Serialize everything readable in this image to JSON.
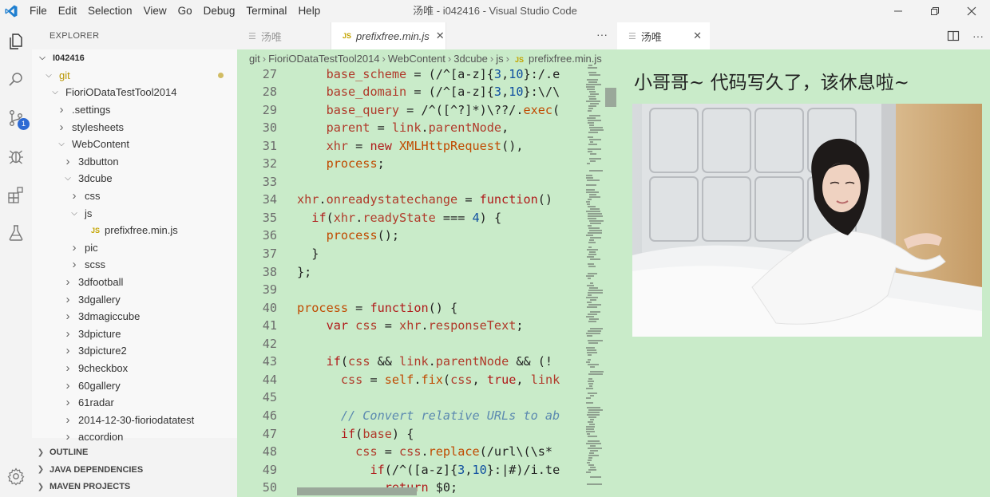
{
  "titlebar": {
    "menu": [
      "File",
      "Edit",
      "Selection",
      "View",
      "Go",
      "Debug",
      "Terminal",
      "Help"
    ],
    "title": "汤唯 - i042416 - Visual Studio Code"
  },
  "activity_bar": {
    "icons": [
      "files-icon",
      "search-icon",
      "source-control-icon",
      "debug-icon",
      "extensions-icon",
      "test-flask-icon"
    ],
    "scm_badge": "1",
    "bottom_icon": "gear-icon"
  },
  "sidebar": {
    "header": "EXPLORER",
    "tree": [
      {
        "label": "I042416",
        "depth": 0,
        "chev": "down",
        "bold": true
      },
      {
        "label": "git",
        "depth": 1,
        "chev": "down",
        "git": true,
        "modified": true
      },
      {
        "label": "FioriODataTestTool2014",
        "depth": 2,
        "chev": "down"
      },
      {
        "label": ".settings",
        "depth": 3,
        "chev": "right"
      },
      {
        "label": "stylesheets",
        "depth": 3,
        "chev": "right"
      },
      {
        "label": "WebContent",
        "depth": 3,
        "chev": "down"
      },
      {
        "label": "3dbutton",
        "depth": 4,
        "chev": "right"
      },
      {
        "label": "3dcube",
        "depth": 4,
        "chev": "down"
      },
      {
        "label": "css",
        "depth": 5,
        "chev": "right"
      },
      {
        "label": "js",
        "depth": 5,
        "chev": "down"
      },
      {
        "label": "prefixfree.min.js",
        "depth": 6,
        "chev": "",
        "js": true
      },
      {
        "label": "pic",
        "depth": 5,
        "chev": "right"
      },
      {
        "label": "scss",
        "depth": 5,
        "chev": "right"
      },
      {
        "label": "3dfootball",
        "depth": 4,
        "chev": "right"
      },
      {
        "label": "3dgallery",
        "depth": 4,
        "chev": "right"
      },
      {
        "label": "3dmagiccube",
        "depth": 4,
        "chev": "right"
      },
      {
        "label": "3dpicture",
        "depth": 4,
        "chev": "right"
      },
      {
        "label": "3dpicture2",
        "depth": 4,
        "chev": "right"
      },
      {
        "label": "9checkbox",
        "depth": 4,
        "chev": "right"
      },
      {
        "label": "60gallery",
        "depth": 4,
        "chev": "right"
      },
      {
        "label": "61radar",
        "depth": 4,
        "chev": "right"
      },
      {
        "label": "2014-12-30-fioriodatatest",
        "depth": 4,
        "chev": "right"
      },
      {
        "label": "accordion",
        "depth": 4,
        "chev": "right"
      }
    ],
    "sections": [
      "OUTLINE",
      "JAVA DEPENDENCIES",
      "MAVEN PROJECTS"
    ]
  },
  "tabs": {
    "inactive_label": "汤唯",
    "active_label": "prefixfree.min.js",
    "js_badge": "JS",
    "more": "···"
  },
  "breadcrumb": [
    "git",
    "FioriODataTestTool2014",
    "WebContent",
    "3dcube",
    "js",
    "prefixfree.min.js"
  ],
  "code": [
    {
      "n": "27",
      "html": "    base_scheme = (/^[a-z]{3,10}:/.e"
    },
    {
      "n": "28",
      "html": "    base_domain = (/^[a-z]{3,10}:\\/\\"
    },
    {
      "n": "29",
      "html": "    base_query = /^([^?]*)\\??/.exec("
    },
    {
      "n": "30",
      "html": "    parent = link.parentNode,"
    },
    {
      "n": "31",
      "html": "    xhr = new XMLHttpRequest(),"
    },
    {
      "n": "32",
      "html": "    process;"
    },
    {
      "n": "33",
      "html": ""
    },
    {
      "n": "34",
      "html": "xhr.onreadystatechange = function()"
    },
    {
      "n": "35",
      "html": "  if(xhr.readyState === 4) {"
    },
    {
      "n": "36",
      "html": "    process();"
    },
    {
      "n": "37",
      "html": "  }"
    },
    {
      "n": "38",
      "html": "};"
    },
    {
      "n": "39",
      "html": ""
    },
    {
      "n": "40",
      "html": "process = function() {"
    },
    {
      "n": "41",
      "html": "    var css = xhr.responseText;"
    },
    {
      "n": "42",
      "html": ""
    },
    {
      "n": "43",
      "html": "    if(css && link.parentNode && (!"
    },
    {
      "n": "44",
      "html": "      css = self.fix(css, true, link"
    },
    {
      "n": "45",
      "html": ""
    },
    {
      "n": "46",
      "html": "      // Convert relative URLs to ab"
    },
    {
      "n": "47",
      "html": "      if(base) {"
    },
    {
      "n": "48",
      "html": "        css = css.replace(/url\\(\\s*"
    },
    {
      "n": "49",
      "html": "          if(/^([a-z]{3,10}:|#)/i.te"
    },
    {
      "n": "50",
      "html": "            return $0;"
    }
  ],
  "right_panel": {
    "tab_label": "汤唯",
    "heading": "小哥哥~ 代码写久了，该休息啦~"
  },
  "colors": {
    "editor_bg": "#c9ebc9",
    "accent_blue": "#2d6ad3",
    "git_yellow": "#b89500"
  }
}
